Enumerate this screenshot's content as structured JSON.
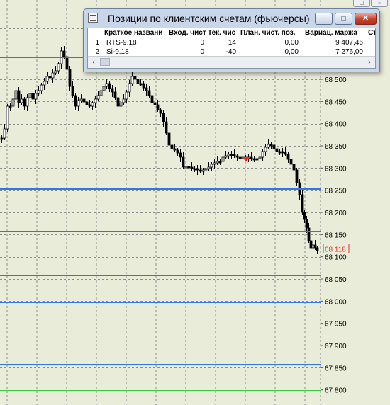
{
  "price_axis": {
    "ticks": [
      "68 500",
      "68 450",
      "68 400",
      "68 350",
      "68 300",
      "68 250",
      "68 200",
      "68 150",
      "68 100",
      "68 050",
      "68 000",
      "67 950",
      "67 900",
      "67 850",
      "67 800"
    ],
    "tick_values": [
      68500,
      68450,
      68400,
      68350,
      68300,
      68250,
      68200,
      68150,
      68100,
      68050,
      68000,
      67950,
      67900,
      67850,
      67800
    ],
    "current_price_label": "68 118",
    "current_price": 68118
  },
  "levels": {
    "blue": [
      68550,
      68253,
      68157,
      68058,
      67998,
      67857
    ],
    "green": [
      67799
    ]
  },
  "colors": {
    "background": "#e9ecd8",
    "grid": "#8c8c8c",
    "level_line": "#2f77e6",
    "green_level": "#38c838",
    "price_line": "#e05a5a",
    "price_label": "#e03030",
    "marker": "#ff2020",
    "window_frame": "#c8d6ea"
  },
  "window": {
    "title": "Позиции по клиентским счетам (фьючерсы)",
    "columns": [
      "Краткое названи",
      "Вход. чист",
      "Тек. чис",
      "План. чист. поз.",
      "Вариац. маржа",
      "Сто"
    ],
    "rows": [
      {
        "n": "1",
        "name": "RTS-9.18",
        "in": "0",
        "cur": "14",
        "plan": "0,00",
        "margin": "9 407,46"
      },
      {
        "n": "2",
        "name": "Si-9.18",
        "in": "0",
        "cur": "-40",
        "plan": "0,00",
        "margin": "7 276,00"
      }
    ],
    "buttons": {
      "minimize": "−",
      "maximize": "□",
      "close": "✕"
    },
    "scroll": {
      "left": "‹",
      "right": "›"
    }
  },
  "top_buttons": [
    "□",
    "▫"
  ]
}
